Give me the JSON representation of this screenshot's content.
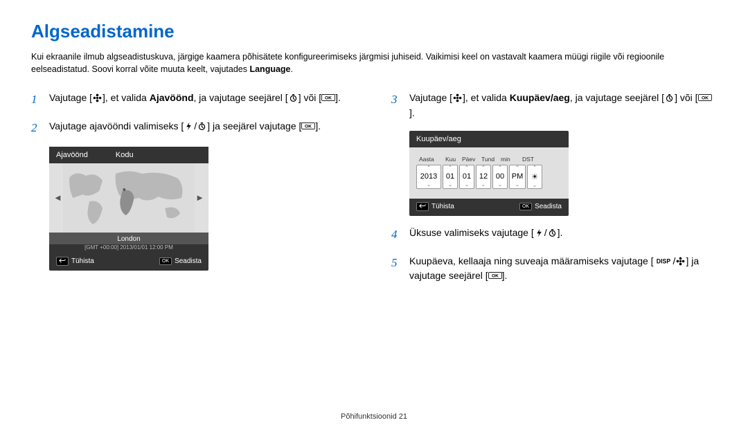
{
  "title": "Algseadistamine",
  "intro_1": "Kui ekraanile ilmub algseadistuskuva, järgige kaamera põhisätete konfigureerimiseks järgmisi juhiseid. Vaikimisi keel on vastavalt kaamera müügi riigile või regioonile eelseadistatud. Soovi korral võite muuta keelt, vajutades ",
  "intro_bold": "Language",
  "intro_2": ".",
  "steps": {
    "s1a": "Vajutage [",
    "s1b": "], et valida ",
    "s1bold": "Ajavöönd",
    "s1c": ", ja vajutage seejärel [",
    "s1d": "] või [",
    "s1e": "].",
    "s2a": "Vajutage ajavööndi valimiseks [",
    "s2b": "/",
    "s2c": "] ja seejärel vajutage [",
    "s2d": "].",
    "s3a": "Vajutage [",
    "s3b": "], et valida ",
    "s3bold": "Kuupäev/aeg",
    "s3c": ", ja vajutage seejärel [",
    "s3d": "] või [",
    "s3e": "].",
    "s4a": "Üksuse valimiseks vajutage [",
    "s4b": "/",
    "s4c": "].",
    "s5a": "Kuupäeva, kellaaja ning suveaja määramiseks vajutage [",
    "s5b": "/",
    "s5c": "] ja vajutage seejärel [",
    "s5d": "]."
  },
  "screen1": {
    "title1": "Ajavöönd",
    "title2": "Kodu",
    "city": "London",
    "gmt": "[GMT +00:00] 2013/01/01 12:00 PM",
    "cancel": "Tühista",
    "set": "Seadista"
  },
  "screen2": {
    "title": "Kuupäev/aeg",
    "labels": {
      "y": "Aasta",
      "m": "Kuu",
      "d": "Päev",
      "h": "Tund",
      "min": "min",
      "dst": "DST"
    },
    "vals": {
      "y": "2013",
      "m": "01",
      "d": "01",
      "h": "12",
      "min": "00",
      "pm": "PM"
    },
    "cancel": "Tühista",
    "set": "Seadista"
  },
  "footer": "Põhifunktsioonid  21"
}
